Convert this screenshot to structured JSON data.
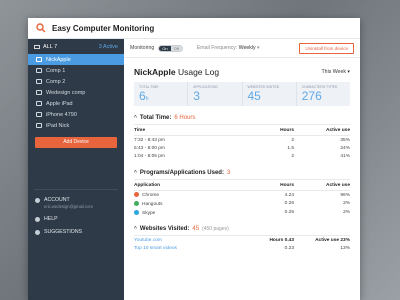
{
  "app": {
    "title": "Easy Computer Monitoring"
  },
  "sidebar": {
    "all_label": "ALL 7",
    "active_label": "3 Active",
    "devices": [
      {
        "label": "NickApple",
        "selected": true
      },
      {
        "label": "Comp 1",
        "selected": false
      },
      {
        "label": "Comp 2",
        "selected": false
      },
      {
        "label": "Wedesign comp",
        "selected": false
      },
      {
        "label": "Apple iPad",
        "selected": false
      },
      {
        "label": "iPhone 4790",
        "selected": false
      },
      {
        "label": "iPad Nick",
        "selected": false
      }
    ],
    "add_device": "Add Device",
    "account": {
      "label": "ACCOUNT",
      "email": "eric.wedesign@gmail.com"
    },
    "help": "HELP",
    "suggestions": "SUGGESTIONS"
  },
  "topbar": {
    "monitoring_label": "Monitoring",
    "toggle_on": "On",
    "toggle_off": "Off",
    "freq_label": "Email Frequency:",
    "freq_value": "Weekly",
    "uninstall": "Uninstall from device"
  },
  "usage": {
    "device": "NickApple",
    "title_suffix": "Usage Log",
    "period": "This Week"
  },
  "stats": [
    {
      "label": "Total time",
      "value": "6",
      "unit": "h"
    },
    {
      "label": "Applications",
      "value": "3",
      "unit": ""
    },
    {
      "label": "Websites visited",
      "value": "45",
      "unit": ""
    },
    {
      "label": "Characters typed",
      "value": "276",
      "unit": ""
    }
  ],
  "total_time": {
    "label": "Total Time:",
    "value": "6 Hours",
    "headers": [
      "Time",
      "Hours",
      "Active use"
    ],
    "rows": [
      [
        "7:32 - 8:43 pm",
        "2",
        "35%"
      ],
      [
        "5:43 - 8:00 pm",
        "1.5",
        "24%"
      ],
      [
        "1:04 - 8:05 pm",
        "2",
        "41%"
      ]
    ]
  },
  "programs": {
    "label": "Programs/Applications Used:",
    "value": "3",
    "headers": [
      "Application",
      "Hours",
      "Active use"
    ],
    "rows": [
      {
        "name": "Chrome",
        "hours": "4.24",
        "active": "96%",
        "color": "#e8643d"
      },
      {
        "name": "Hangouts",
        "hours": "0.26",
        "active": "2%",
        "color": "#3fae5a"
      },
      {
        "name": "Skype",
        "hours": "0.25",
        "active": "2%",
        "color": "#2aa5e0"
      }
    ]
  },
  "websites": {
    "label": "Websites Visited:",
    "value": "45",
    "pages": "(450 pages)",
    "row1": {
      "site": "Youtube.com",
      "hours": "Hours 0.43",
      "active": "Active use 23%"
    },
    "row2": {
      "site": "Top 10 smart videos",
      "hours": "0.23",
      "active": "13%"
    }
  },
  "colors": {
    "accent": "#e8643d",
    "blue": "#4a9be2",
    "sidebar": "#2e3a48"
  }
}
